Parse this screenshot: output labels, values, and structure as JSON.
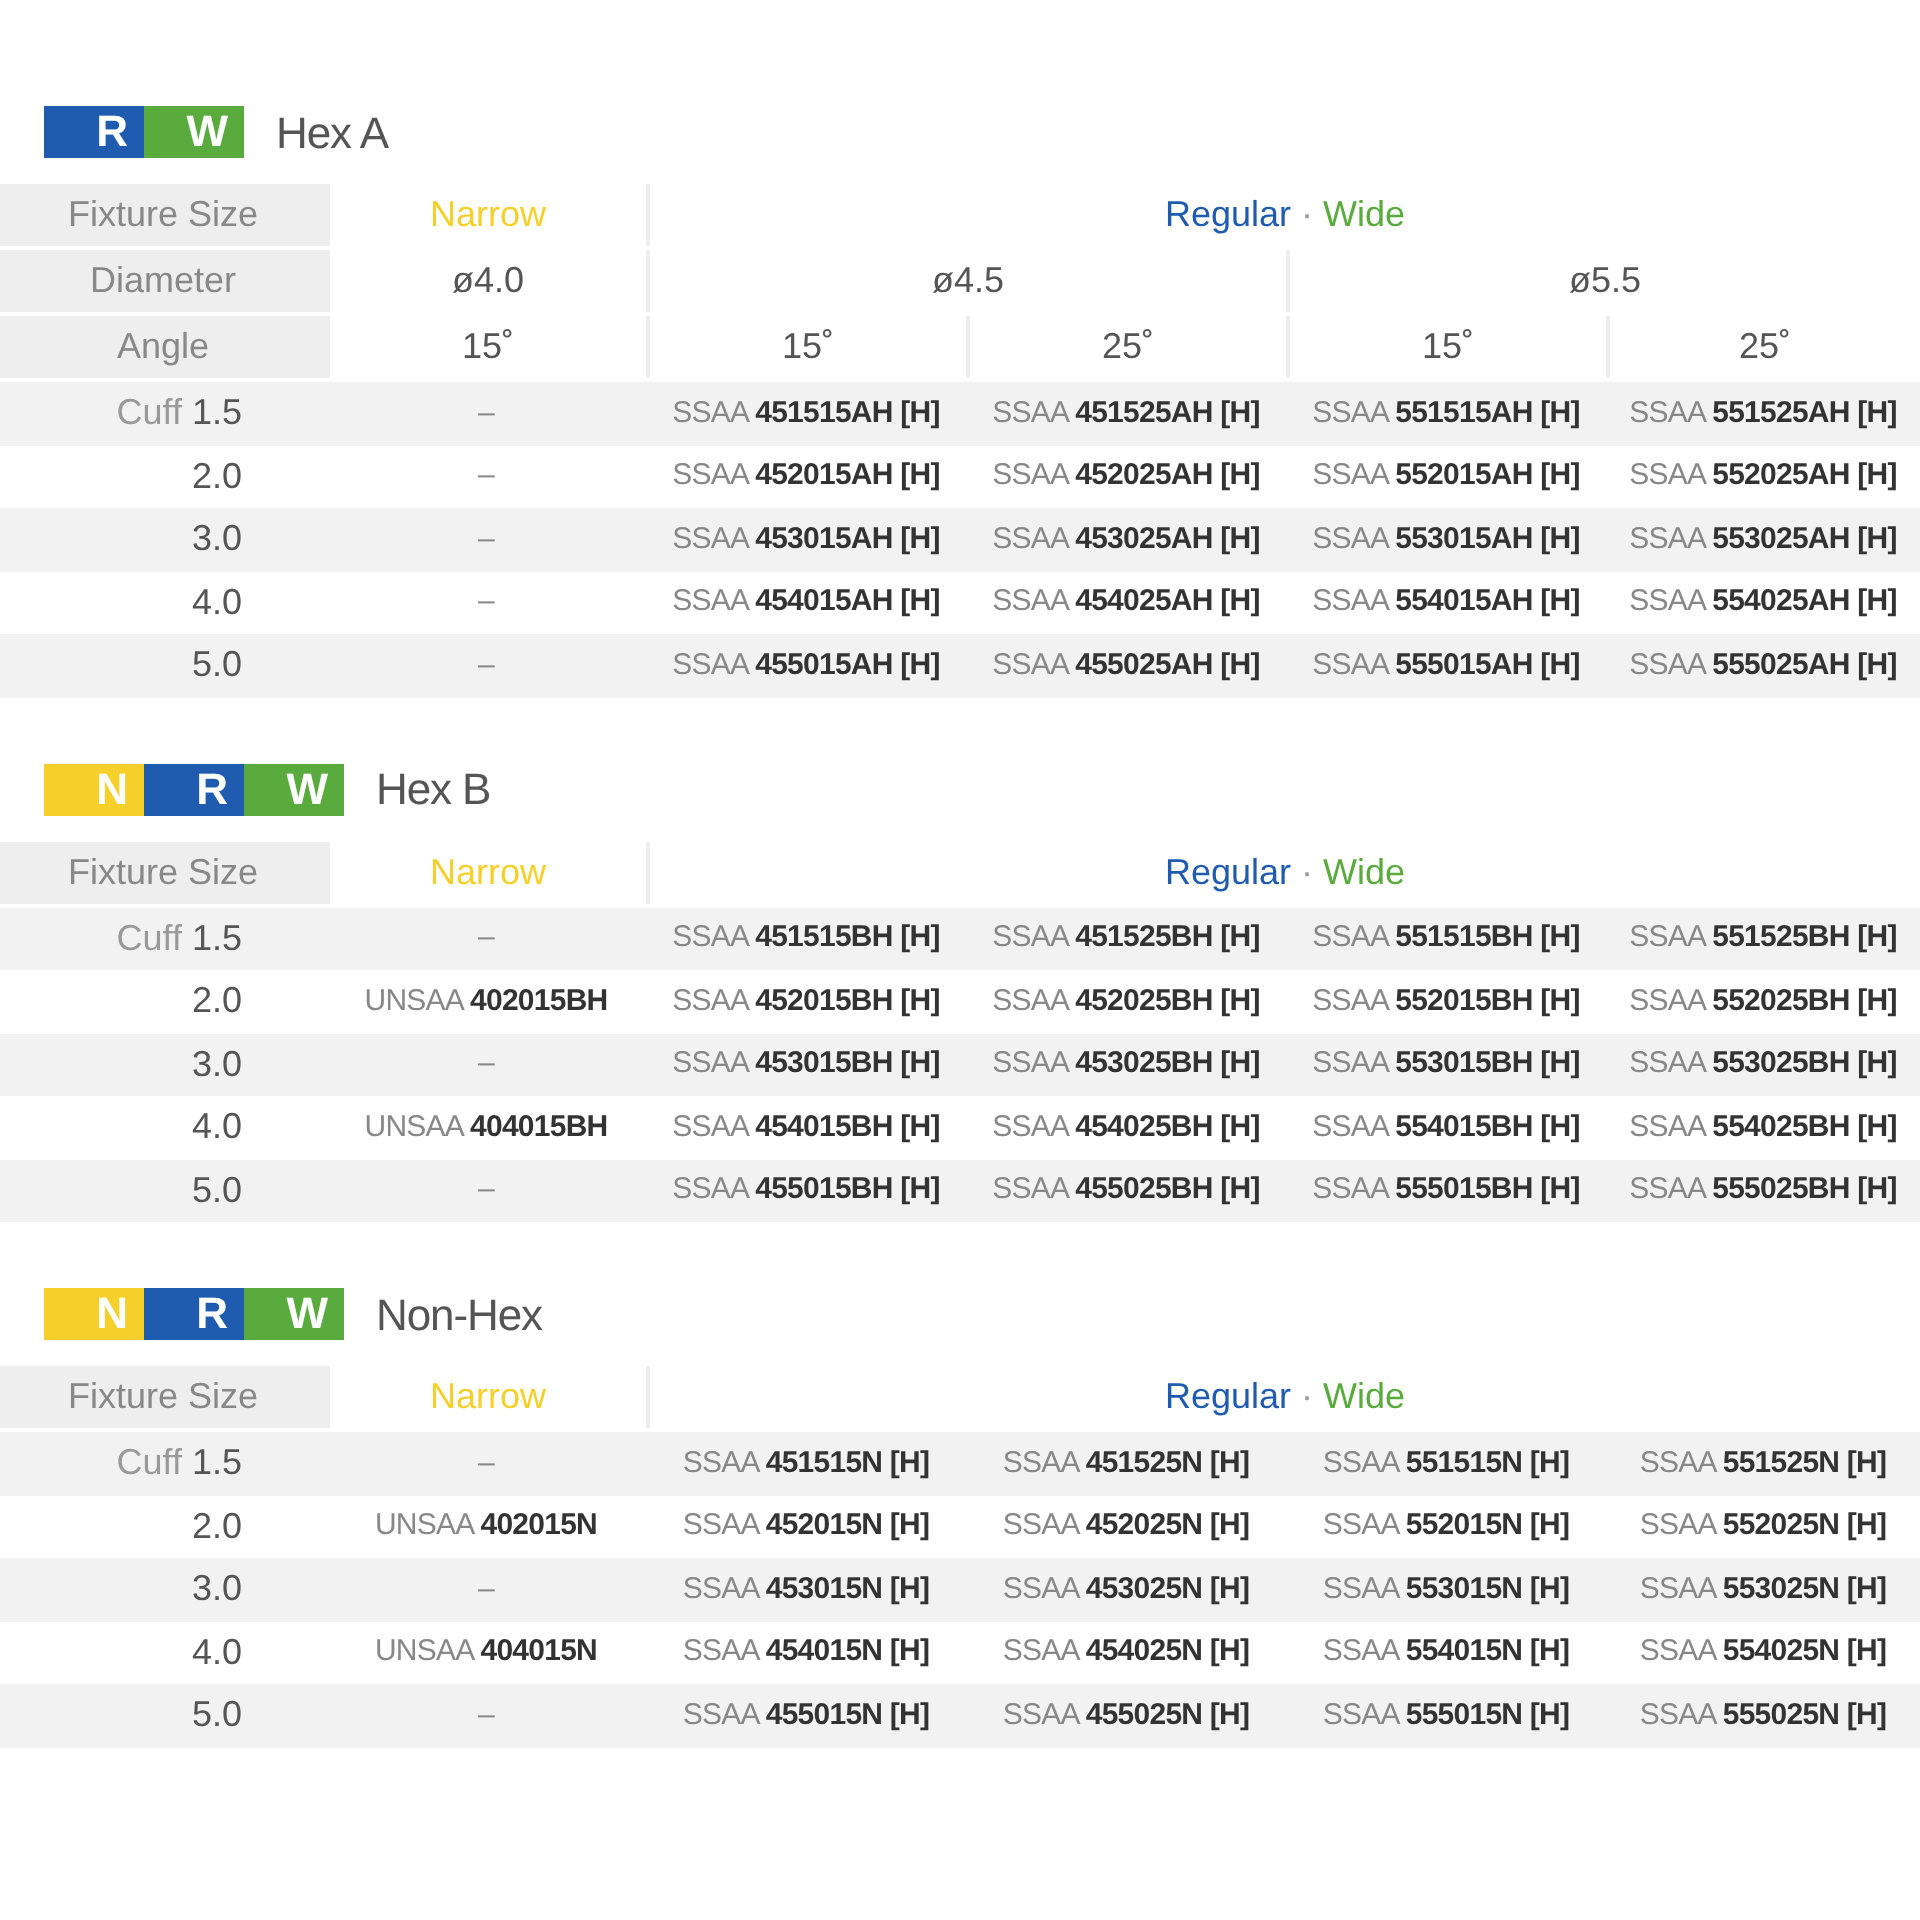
{
  "sections": [
    {
      "badges": [
        {
          "letter": "R",
          "color": "#1f5cb0"
        },
        {
          "letter": "W",
          "color": "#5aab3d"
        }
      ],
      "title": "Hex A",
      "header_rows": [
        {
          "label": "Fixture Size",
          "cells": [
            [
              {
                "text": "Narrow",
                "color": "#f5d02a"
              }
            ],
            [
              {
                "text": "Regular",
                "color": "#1f5cb0"
              },
              {
                "text": " · ",
                "color": "#9a9a9a"
              },
              {
                "text": "Wide",
                "color": "#5aab3d"
              }
            ]
          ]
        },
        {
          "label": "Diameter",
          "cells": [
            [
              {
                "text": "ø4.0",
                "color": "#555555"
              }
            ],
            [
              {
                "text": "ø4.5",
                "color": "#555555"
              }
            ],
            [
              {
                "text": "ø5.5",
                "color": "#555555"
              }
            ]
          ]
        },
        {
          "label": "Angle",
          "cells": [
            [
              {
                "text": "15˚",
                "color": "#555555"
              }
            ],
            [
              {
                "text": "15˚",
                "color": "#555555"
              }
            ],
            [
              {
                "text": "25˚",
                "color": "#555555"
              }
            ],
            [
              {
                "text": "15˚",
                "color": "#555555"
              }
            ],
            [
              {
                "text": "25˚",
                "color": "#555555"
              }
            ]
          ]
        }
      ],
      "rows": [
        {
          "label": "Cuff **1.5**",
          "cells": [
            "–",
            "SSAA **451515AH [H]**",
            "SSAA **451525AH [H]**",
            "SSAA **551515AH [H]**",
            "SSAA **551525AH [H]**"
          ]
        },
        {
          "label": "**2.0**",
          "cells": [
            "–",
            "SSAA **452015AH [H]**",
            "SSAA **452025AH [H]**",
            "SSAA **552015AH [H]**",
            "SSAA **552025AH [H]**"
          ]
        },
        {
          "label": "**3.0**",
          "cells": [
            "–",
            "SSAA **453015AH [H]**",
            "SSAA **453025AH [H]**",
            "SSAA **553015AH [H]**",
            "SSAA **553025AH [H]**"
          ]
        },
        {
          "label": "**4.0**",
          "cells": [
            "–",
            "SSAA **454015AH [H]**",
            "SSAA **454025AH [H]**",
            "SSAA **554015AH [H]**",
            "SSAA **554025AH [H]**"
          ]
        },
        {
          "label": "**5.0**",
          "cells": [
            "–",
            "SSAA **455015AH [H]**",
            "SSAA **455025AH [H]**",
            "SSAA **555015AH [H]**",
            "SSAA **555025AH [H]**"
          ]
        }
      ]
    },
    {
      "badges": [
        {
          "letter": "N",
          "color": "#f5d02a"
        },
        {
          "letter": "R",
          "color": "#1f5cb0"
        },
        {
          "letter": "W",
          "color": "#5aab3d"
        }
      ],
      "title": "Hex B",
      "header_rows": [
        {
          "label": "Fixture Size",
          "cells": [
            [
              {
                "text": "Narrow",
                "color": "#f5d02a"
              }
            ],
            [
              {
                "text": "Regular",
                "color": "#1f5cb0"
              },
              {
                "text": " · ",
                "color": "#9a9a9a"
              },
              {
                "text": "Wide",
                "color": "#5aab3d"
              }
            ]
          ]
        }
      ],
      "rows": [
        {
          "label": "Cuff **1.5**",
          "cells": [
            "–",
            "SSAA **451515BH [H]**",
            "SSAA **451525BH [H]**",
            "SSAA **551515BH [H]**",
            "SSAA **551525BH [H]**"
          ]
        },
        {
          "label": "**2.0**",
          "cells": [
            "UNSAA **402015BH**",
            "SSAA **452015BH [H]**",
            "SSAA **452025BH [H]**",
            "SSAA **552015BH [H]**",
            "SSAA **552025BH [H]**"
          ]
        },
        {
          "label": "**3.0**",
          "cells": [
            "–",
            "SSAA **453015BH [H]**",
            "SSAA **453025BH [H]**",
            "SSAA **553015BH [H]**",
            "SSAA **553025BH [H]**"
          ]
        },
        {
          "label": "**4.0**",
          "cells": [
            "UNSAA **404015BH**",
            "SSAA **454015BH [H]**",
            "SSAA **454025BH [H]**",
            "SSAA **554015BH [H]**",
            "SSAA **554025BH [H]**"
          ]
        },
        {
          "label": "**5.0**",
          "cells": [
            "–",
            "SSAA **455015BH [H]**",
            "SSAA **455025BH [H]**",
            "SSAA **555015BH [H]**",
            "SSAA **555025BH [H]**"
          ]
        }
      ]
    },
    {
      "badges": [
        {
          "letter": "N",
          "color": "#f5d02a"
        },
        {
          "letter": "R",
          "color": "#1f5cb0"
        },
        {
          "letter": "W",
          "color": "#5aab3d"
        }
      ],
      "title": "Non-Hex",
      "header_rows": [
        {
          "label": "Fixture Size",
          "cells": [
            [
              {
                "text": "Narrow",
                "color": "#f5d02a"
              }
            ],
            [
              {
                "text": "Regular",
                "color": "#1f5cb0"
              },
              {
                "text": " · ",
                "color": "#9a9a9a"
              },
              {
                "text": "Wide",
                "color": "#5aab3d"
              }
            ]
          ]
        }
      ],
      "rows": [
        {
          "label": "Cuff **1.5**",
          "cells": [
            "–",
            "SSAA **451515N [H]**",
            "SSAA **451525N [H]**",
            "SSAA **551515N [H]**",
            "SSAA **551525N [H]**"
          ]
        },
        {
          "label": "**2.0**",
          "cells": [
            "UNSAA **402015N**",
            "SSAA **452015N [H]**",
            "SSAA **452025N [H]**",
            "SSAA **552015N [H]**",
            "SSAA **552025N [H]**"
          ]
        },
        {
          "label": "**3.0**",
          "cells": [
            "–",
            "SSAA **453015N [H]**",
            "SSAA **453025N [H]**",
            "SSAA **553015N [H]**",
            "SSAA **553025N [H]**"
          ]
        },
        {
          "label": "**4.0**",
          "cells": [
            "UNSAA **404015N**",
            "SSAA **454015N [H]**",
            "SSAA **454025N [H]**",
            "SSAA **554015N [H]**",
            "SSAA **554025N [H]**"
          ]
        },
        {
          "label": "**5.0**",
          "cells": [
            "–",
            "SSAA **455015N [H]**",
            "SSAA **455025N [H]**",
            "SSAA **555015N [H]**",
            "SSAA **555025N [H]**"
          ]
        }
      ]
    }
  ]
}
